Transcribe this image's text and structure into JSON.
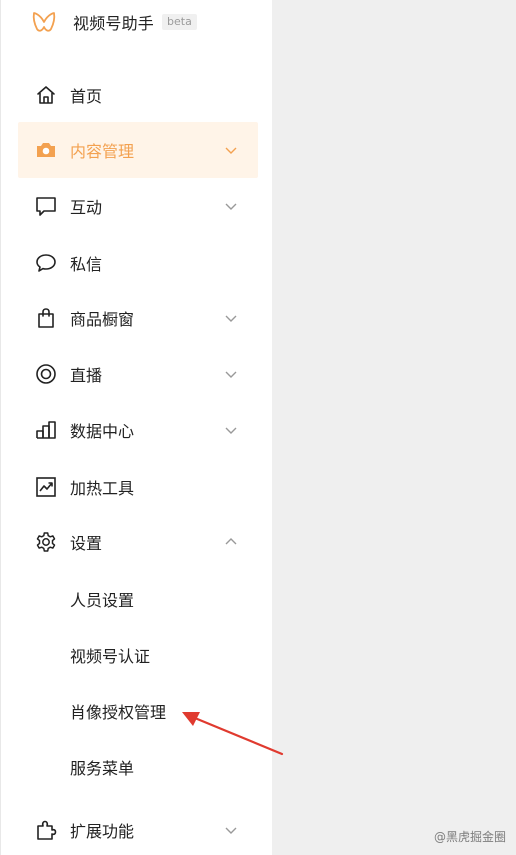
{
  "brand": {
    "title": "视频号助手",
    "badge": "beta",
    "logo_icon": "butterfly-logo",
    "logo_color": "#f3a150"
  },
  "colors": {
    "accent": "#f3a150",
    "active_bg": "#fff4e8",
    "text": "#222222",
    "icon": "#222222"
  },
  "sidebar": {
    "items": [
      {
        "label": "首页",
        "icon": "home-icon",
        "active": false,
        "has_chevron": false
      },
      {
        "label": "内容管理",
        "icon": "camera-icon",
        "active": true,
        "has_chevron": true,
        "expanded": false
      },
      {
        "label": "互动",
        "icon": "comment-icon",
        "active": false,
        "has_chevron": true,
        "expanded": false
      },
      {
        "label": "私信",
        "icon": "chat-bubble-icon",
        "active": false,
        "has_chevron": false
      },
      {
        "label": "商品橱窗",
        "icon": "shopping-bag-icon",
        "active": false,
        "has_chevron": true,
        "expanded": false
      },
      {
        "label": "直播",
        "icon": "live-icon",
        "active": false,
        "has_chevron": true,
        "expanded": false
      },
      {
        "label": "数据中心",
        "icon": "bar-chart-icon",
        "active": false,
        "has_chevron": true,
        "expanded": false
      },
      {
        "label": "加热工具",
        "icon": "trend-chart-icon",
        "active": false,
        "has_chevron": false
      },
      {
        "label": "设置",
        "icon": "gear-icon",
        "active": false,
        "has_chevron": true,
        "expanded": true
      },
      {
        "label": "扩展功能",
        "icon": "puzzle-icon",
        "active": false,
        "has_chevron": true,
        "expanded": false
      }
    ],
    "settings_submenu": [
      "人员设置",
      "视频号认证",
      "肖像授权管理",
      "服务菜单"
    ]
  },
  "annotation": {
    "arrow_color": "#e03a2f",
    "target_label": "肖像授权管理"
  },
  "watermark": {
    "text": "@黑虎掘金圈"
  }
}
